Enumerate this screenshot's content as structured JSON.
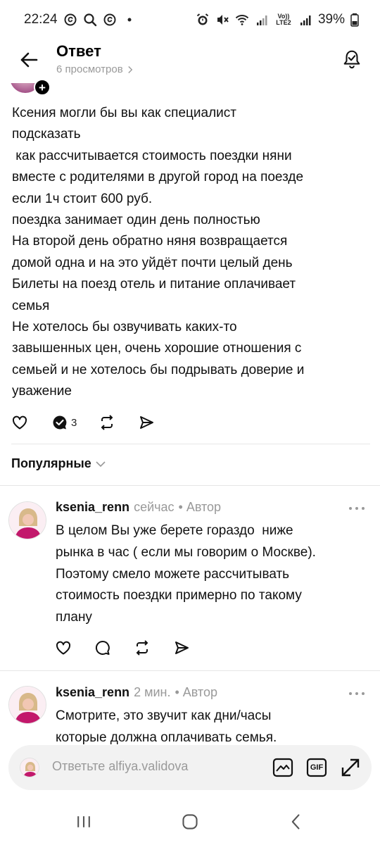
{
  "status_bar": {
    "time": "22:24",
    "left_icons": [
      "threads-icon",
      "search-icon",
      "threads-icon",
      "dot-icon"
    ],
    "right_icons": [
      "alarm-icon",
      "mute-icon",
      "wifi-icon",
      "signal-icon",
      "lte-icon",
      "signal-icon"
    ],
    "lte_label": "Vo)) LTE2",
    "battery": "39%"
  },
  "header": {
    "title": "Ответ",
    "views": "6 просмотров"
  },
  "post": {
    "text": "Ксения могли бы вы как специалист\nподсказать\n как рассчитывается стоимость поездки няни\nвместе с родителями в другой город на поезде\nесли 1ч стоит 600 руб.\nпоездка занимает один день полностью\nНа второй день обратно няня возвращается\nдомой одна и на это уйдёт почти целый день\nБилеты на поезд отель и питание оплачивает\nсемья\nНе хотелось бы озвучивать каких-то\nзавышенных цен, очень хорошие отношения с\nсемьей и не хотелось бы подрывать доверие и\nуважение",
    "reply_count": "3"
  },
  "sort": {
    "label": "Популярные"
  },
  "comments": [
    {
      "author": "ksenia_renn",
      "time": "сейчас",
      "badge": "• Автор",
      "text": "В целом Вы уже берете гораздо  ниже\nрынка в час ( если мы говорим о Москве).\nПоэтому смело можете рассчитывать\nстоимость поездки примерно по такому\nплану"
    },
    {
      "author": "ksenia_renn",
      "time": "2 мин.",
      "badge": "• Автор",
      "text": "Смотрите, это звучит как дни/часы\nкоторые должна оплачивать семья."
    }
  ],
  "reply_bar": {
    "placeholder": "Ответьте alfiya.validova",
    "gif_label": "GIF"
  },
  "colors": {
    "text": "#111111",
    "muted": "#999999",
    "divider": "#e6e6e6",
    "reply_bg": "#f2f2f2",
    "avatar_accent": "#c2186b"
  }
}
